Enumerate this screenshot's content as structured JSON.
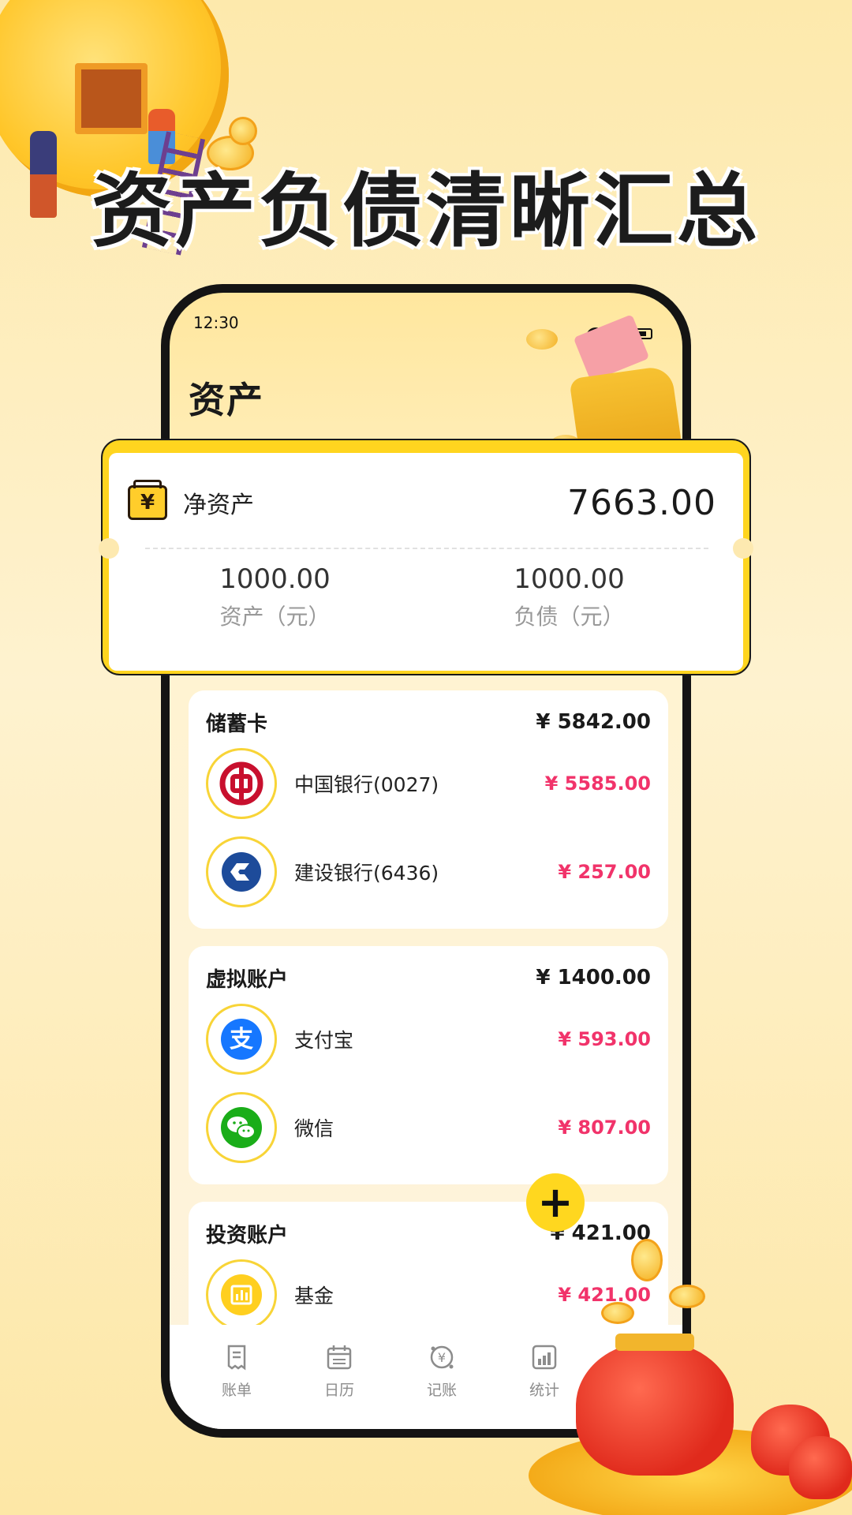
{
  "hero": {
    "title": "资产负债清晰汇总"
  },
  "status_bar": {
    "time": "12:30"
  },
  "screen": {
    "title": "资产"
  },
  "net_assets": {
    "label": "净资产",
    "value": "7663.00",
    "assets_value": "1000.00",
    "assets_label": "资产（元）",
    "liabilities_value": "1000.00",
    "liabilities_label": "负债（元）"
  },
  "sections": [
    {
      "title": "储蓄卡",
      "total": "¥ 5842.00",
      "accounts": [
        {
          "name": "中国银行(0027)",
          "amount": "¥ 5585.00",
          "icon": "boc-icon"
        },
        {
          "name": "建设银行(6436)",
          "amount": "¥ 257.00",
          "icon": "ccb-icon"
        }
      ]
    },
    {
      "title": "虚拟账户",
      "total": "¥ 1400.00",
      "accounts": [
        {
          "name": "支付宝",
          "amount": "¥ 593.00",
          "icon": "alipay-icon"
        },
        {
          "name": "微信",
          "amount": "¥ 807.00",
          "icon": "wechat-icon"
        }
      ]
    },
    {
      "title": "投资账户",
      "total": "¥ 421.00",
      "accounts": [
        {
          "name": "基金",
          "amount": "¥ 421.00",
          "icon": "fund-icon"
        }
      ]
    }
  ],
  "fab": {
    "label": "+"
  },
  "nav": [
    {
      "label": "账单",
      "icon": "bill-icon"
    },
    {
      "label": "日历",
      "icon": "calendar-icon"
    },
    {
      "label": "记账",
      "icon": "record-icon"
    },
    {
      "label": "统计",
      "icon": "chart-icon"
    }
  ],
  "colors": {
    "accent": "#ffd71f",
    "amount": "#f1336a",
    "boc_red": "#c8102e",
    "ccb_blue": "#1d4b9a",
    "alipay_blue": "#1677ff",
    "wechat_green": "#1aad19"
  }
}
